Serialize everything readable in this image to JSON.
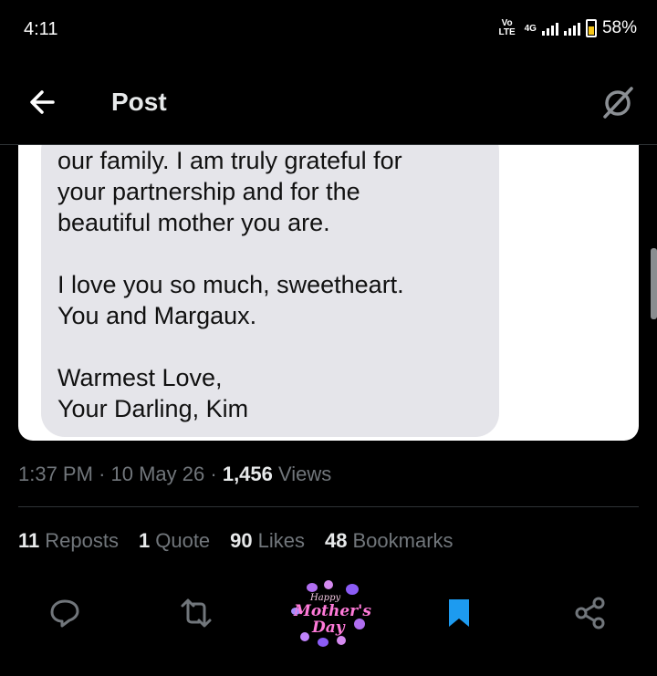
{
  "status_bar": {
    "time": "4:11",
    "network_label": "VoLTE",
    "network_type": "4G",
    "battery": "58%"
  },
  "header": {
    "title": "Post",
    "back_icon": "arrow-left-icon",
    "grok_icon": "grok-icon"
  },
  "post": {
    "message_text": "our family. I am truly grateful for\nyour partnership and for the\nbeautiful mother you are.\n\nI love you so much, sweetheart.\nYou and Margaux.\n\nWarmest Love,\nYour Darling, Kim",
    "time": "1:37 PM",
    "date": "10 May 26",
    "views_count": "1,456",
    "views_label": "Views",
    "separator": "·"
  },
  "stats": {
    "reposts_count": "11",
    "reposts_label": "Reposts",
    "quotes_count": "1",
    "quotes_label": "Quote",
    "likes_count": "90",
    "likes_label": "Likes",
    "bookmarks_count": "48",
    "bookmarks_label": "Bookmarks"
  },
  "actions": {
    "reply_icon": "reply-icon",
    "repost_icon": "repost-icon",
    "like_sticker": {
      "line1": "Happy",
      "line2": "Mother's",
      "line3": "Day"
    },
    "bookmark_icon": "bookmark-icon",
    "share_icon": "share-icon"
  },
  "colors": {
    "background": "#000000",
    "text_primary": "#e7e9ea",
    "text_secondary": "#71767b",
    "bookmark_active": "#1d9bf0",
    "bubble": "#e5e5ea"
  }
}
